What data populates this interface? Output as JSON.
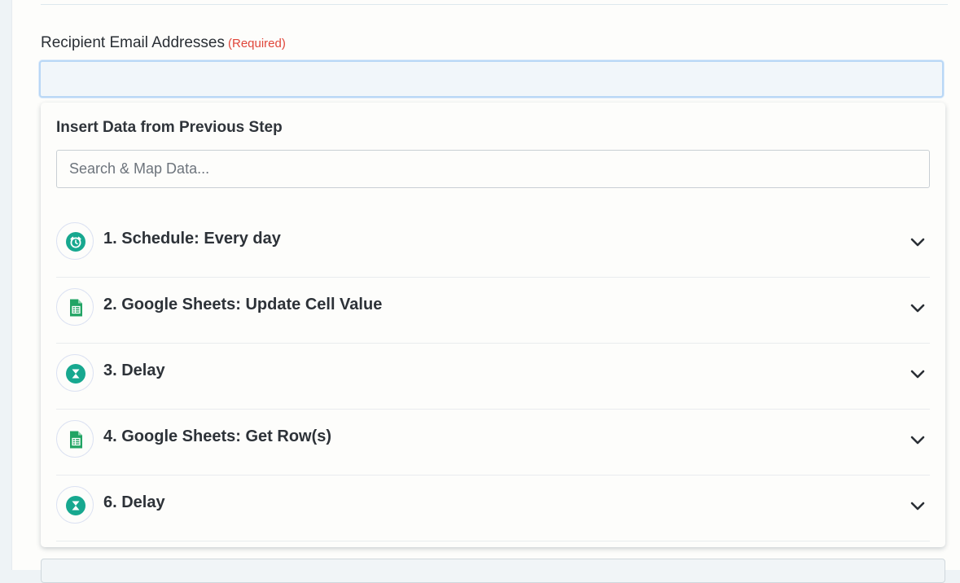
{
  "form": {
    "field_label": "Recipient Email Addresses",
    "required_label": "(Required)",
    "email_value": ""
  },
  "data_picker": {
    "title": "Insert Data from Previous Step",
    "search_placeholder": "Search & Map Data...",
    "steps": [
      {
        "label": "1. Schedule: Every day",
        "icon": "alarm-clock-icon"
      },
      {
        "label": "2. Google Sheets: Update Cell Value",
        "icon": "google-sheets-icon"
      },
      {
        "label": "3. Delay",
        "icon": "hourglass-icon"
      },
      {
        "label": "4. Google Sheets: Get Row(s)",
        "icon": "google-sheets-icon"
      },
      {
        "label": "6. Delay",
        "icon": "hourglass-icon"
      }
    ]
  },
  "colors": {
    "required_red": "#e0463a",
    "app_teal": "#17a88f",
    "sheets_green": "#21a464",
    "focus_blue": "#b9d7f6"
  }
}
